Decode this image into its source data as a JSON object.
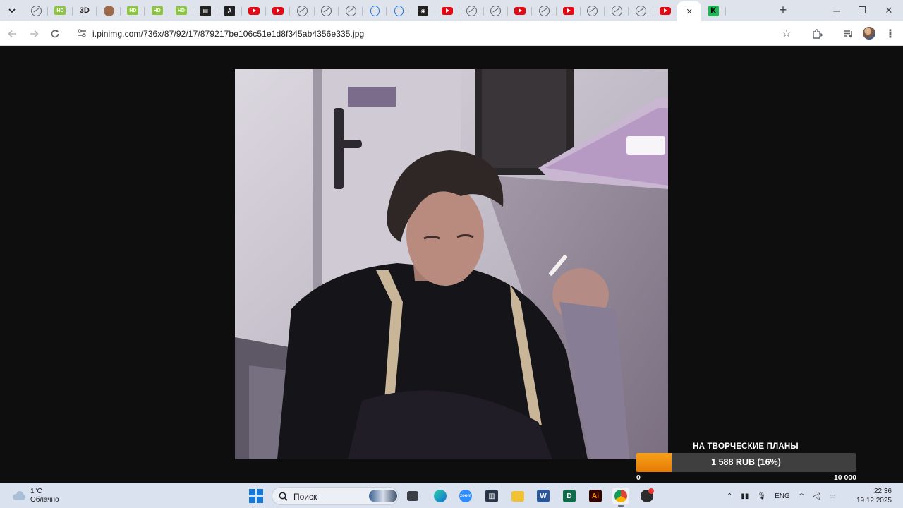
{
  "browser": {
    "active_tab_close": "×",
    "new_tab": "+",
    "tabs": [
      {
        "icon": "globe-icon",
        "kind": "globe",
        "text": ""
      },
      {
        "icon": "hd-icon",
        "kind": "hd",
        "text": "HD"
      },
      {
        "icon": "3d-icon",
        "kind": "three",
        "text": "3D"
      },
      {
        "icon": "face-icon",
        "kind": "face",
        "text": ""
      },
      {
        "icon": "hd-icon",
        "kind": "hd",
        "text": "HD"
      },
      {
        "icon": "hd-icon",
        "kind": "hd",
        "text": "HD"
      },
      {
        "icon": "hd-icon",
        "kind": "hd",
        "text": "HD"
      },
      {
        "icon": "film-icon",
        "kind": "dark",
        "text": "▤"
      },
      {
        "icon": "a-logo-icon",
        "kind": "dark",
        "text": "A"
      },
      {
        "icon": "youtube-icon",
        "kind": "yt",
        "text": ""
      },
      {
        "icon": "youtube-icon",
        "kind": "yt",
        "text": ""
      },
      {
        "icon": "globe-icon",
        "kind": "globe",
        "text": ""
      },
      {
        "icon": "globe-icon",
        "kind": "globe",
        "text": ""
      },
      {
        "icon": "globe-icon",
        "kind": "globe",
        "text": ""
      },
      {
        "icon": "opera-icon",
        "kind": "opera",
        "text": ""
      },
      {
        "icon": "opera-icon",
        "kind": "opera",
        "text": ""
      },
      {
        "icon": "video-icon",
        "kind": "dark",
        "text": "◉"
      },
      {
        "icon": "youtube-icon",
        "kind": "yt",
        "text": ""
      },
      {
        "icon": "globe-icon",
        "kind": "globe",
        "text": ""
      },
      {
        "icon": "globe-icon",
        "kind": "globe",
        "text": ""
      },
      {
        "icon": "youtube-icon",
        "kind": "yt",
        "text": ""
      },
      {
        "icon": "globe-icon",
        "kind": "globe",
        "text": ""
      },
      {
        "icon": "youtube-icon",
        "kind": "yt",
        "text": ""
      },
      {
        "icon": "globe-icon",
        "kind": "globe",
        "text": ""
      },
      {
        "icon": "globe-icon",
        "kind": "globe",
        "text": ""
      },
      {
        "icon": "globe-icon",
        "kind": "globe",
        "text": ""
      },
      {
        "icon": "youtube-icon",
        "kind": "yt",
        "text": ""
      },
      {
        "icon": "close-icon",
        "kind": "active",
        "text": "×"
      },
      {
        "icon": "k-logo-icon",
        "kind": "k",
        "text": "K"
      }
    ],
    "url": "i.pinimg.com/736x/87/92/17/879217be106c51e1d8f345ab4356e335.jpg"
  },
  "donation": {
    "title": "НА ТВОРЧЕСКИЕ ПЛАНЫ",
    "amount": "1 588 RUB (16%)",
    "progress": 0.16,
    "min": "0",
    "max": "10 000",
    "bar_color": "#f39212"
  },
  "taskbar": {
    "temperature": "1°C",
    "condition": "Облачно",
    "search_placeholder": "Поиск",
    "language": "ENG",
    "time": "22:36",
    "date": "19.12.2025"
  }
}
